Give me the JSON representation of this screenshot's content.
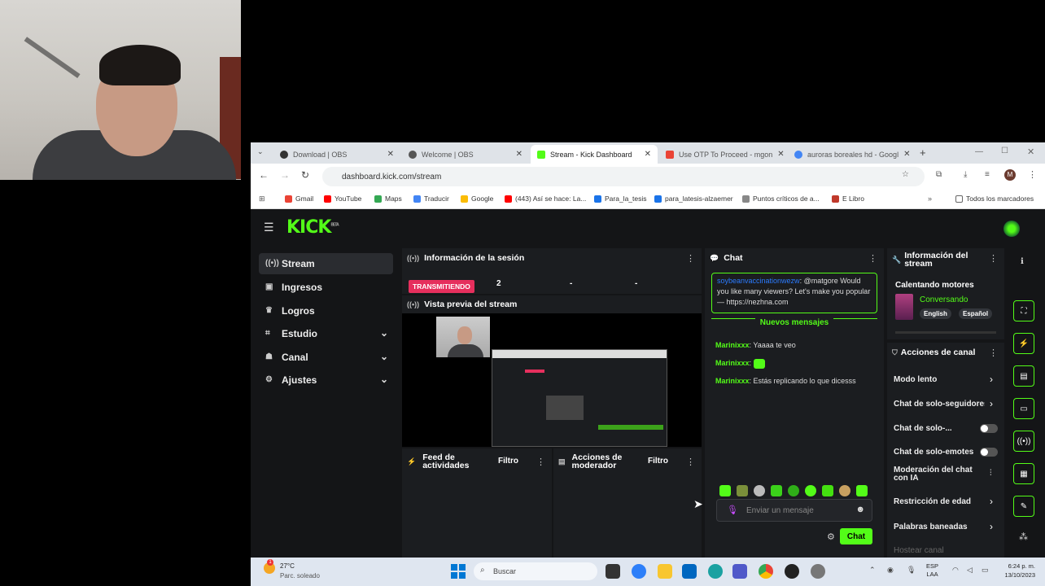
{
  "browser": {
    "tabs": [
      {
        "label": "Download | OBS",
        "active": false
      },
      {
        "label": "Welcome | OBS",
        "active": false
      },
      {
        "label": "Stream - Kick Dashboard",
        "active": true
      },
      {
        "label": "Use OTP To Proceed - mgon",
        "active": false
      },
      {
        "label": "auroras boreales hd - Googl",
        "active": false
      }
    ],
    "url": "dashboard.kick.com/stream",
    "bookmarks": [
      "Gmail",
      "YouTube",
      "Maps",
      "Traducir",
      "Google",
      "(443) Así se hace: La...",
      "Para_la_tesis",
      "para_latesis-alzaemer",
      "Puntos críticos de a...",
      "E Libro"
    ],
    "bookmarks_all": "Todos los marcadores"
  },
  "kick": {
    "logo": "KICK",
    "logo_badge": "BETA",
    "sidebar": [
      {
        "label": "Stream",
        "icon": "broadcast-icon"
      },
      {
        "label": "Ingresos",
        "icon": "income-icon"
      },
      {
        "label": "Logros",
        "icon": "trophy-icon"
      },
      {
        "label": "Estudio",
        "icon": "studio-icon"
      },
      {
        "label": "Canal",
        "icon": "channel-icon"
      },
      {
        "label": "Ajustes",
        "icon": "gear-icon"
      }
    ],
    "session": {
      "title": "Información de la sesión",
      "status": "TRANSMITIENDO",
      "viewers": "2",
      "stat2": "-",
      "stat3": "-"
    },
    "preview": {
      "title": "Vista previa del stream"
    },
    "feed": {
      "title": "Feed de actividades",
      "filter": "Filtro"
    },
    "mod_actions": {
      "title": "Acciones de moderador",
      "filter": "Filtro"
    },
    "chat": {
      "title": "Chat",
      "pinned_user": "soybeanvaccinationwezw",
      "pinned_text": ": @matgore Would you like many viewers? Let's make you popular — https://nezhna.com",
      "new_messages": "Nuevos mensajes",
      "messages": [
        {
          "user": "Marinixxx",
          "text": ": Yaaaa te veo"
        },
        {
          "user": "Marinixxx",
          "text": ":"
        },
        {
          "user": "Marinixxx",
          "text": ": Estás replicando lo que dicesss"
        }
      ],
      "input_placeholder": "Enviar un mensaje",
      "send_label": "Chat"
    },
    "stream_info": {
      "title": "Información del stream",
      "stream_title": "Calentando motores",
      "category": "Conversando",
      "tags": [
        "English",
        "Español"
      ]
    },
    "channel_actions": {
      "title": "Acciones de canal",
      "items": [
        {
          "label": "Modo lento",
          "control": "chevron"
        },
        {
          "label": "Chat de solo-seguidores",
          "control": "chevron"
        },
        {
          "label": "Chat de solo-...",
          "control": "toggle"
        },
        {
          "label": "Chat de solo-emotes",
          "control": "toggle"
        },
        {
          "label": "Moderación del chat con IA",
          "control": "chart"
        },
        {
          "label": "Restricción de edad",
          "control": "chevron"
        },
        {
          "label": "Palabras baneadas",
          "control": "chevron"
        },
        {
          "label": "Hostear canal",
          "control": "none"
        }
      ]
    }
  },
  "taskbar": {
    "weather_temp": "27°C",
    "weather_desc": "Parc. soleado",
    "search_placeholder": "Buscar",
    "lang": "ESP",
    "lang2": "LAA",
    "time": "6:24 p. m.",
    "date": "13/10/2023"
  },
  "colors": {
    "kick_green": "#53fc18",
    "live_red": "#e62f5d",
    "panel_bg": "#1b1d20",
    "page_bg": "#141517"
  }
}
